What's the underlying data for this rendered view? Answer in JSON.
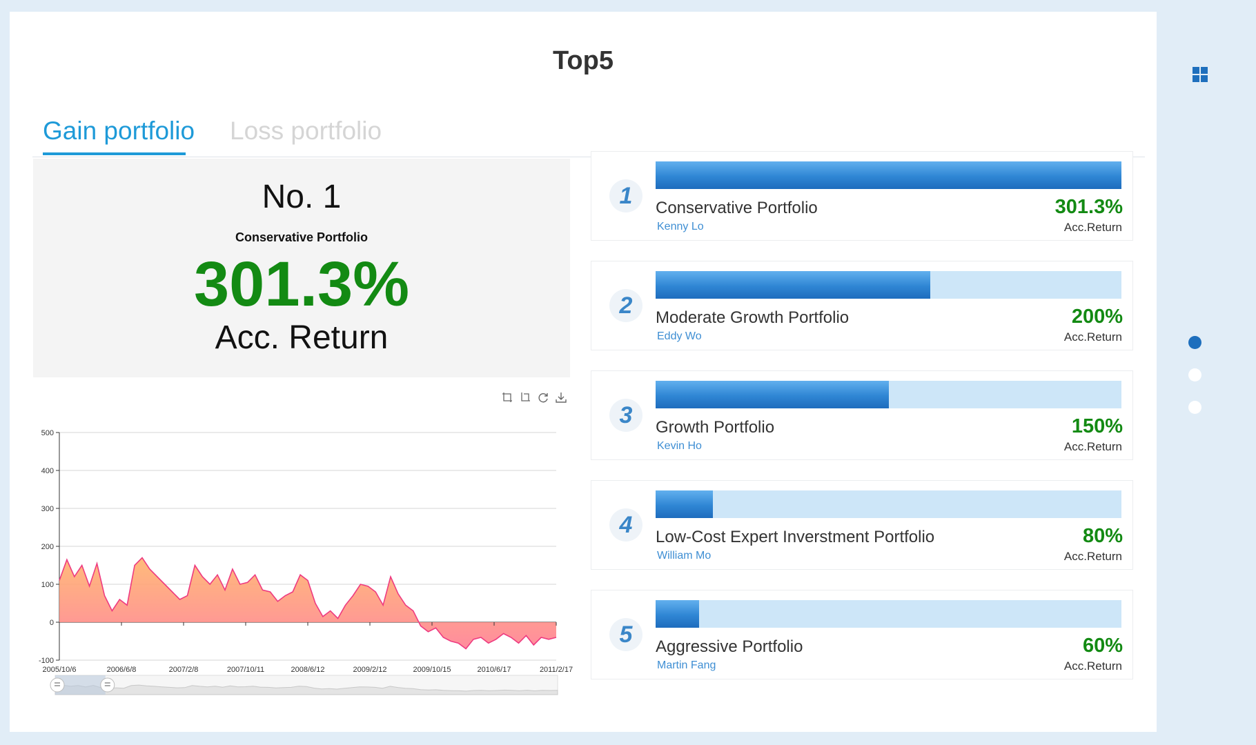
{
  "page": {
    "title": "Top5"
  },
  "tabs": [
    {
      "label": "Gain portfolio",
      "active": true
    },
    {
      "label": "Loss portfolio",
      "active": false
    }
  ],
  "hero": {
    "rank": "No. 1",
    "name": "Conservative Portfolio",
    "value": "301.3%",
    "label": "Acc. Return"
  },
  "toolbox": {
    "icons": [
      "zoom-icon",
      "zoom-reset-icon",
      "restore-icon",
      "download-icon"
    ]
  },
  "ranking": [
    {
      "rank": "1",
      "name": "Conservative Portfolio",
      "owner": "Kenny Lo",
      "value": "301.3%",
      "label": "Acc.Return",
      "fill": 1.0
    },
    {
      "rank": "2",
      "name": "Moderate Growth Portfolio",
      "owner": "Eddy Wo",
      "value": "200%",
      "label": "Acc.Return",
      "fill": 0.589
    },
    {
      "rank": "3",
      "name": "Growth Portfolio",
      "owner": "Kevin Ho",
      "value": "150%",
      "label": "Acc.Return",
      "fill": 0.501
    },
    {
      "rank": "4",
      "name": "Low-Cost Expert Inverstment Portfolio",
      "owner": "William Mo",
      "value": "80%",
      "label": "Acc.Return",
      "fill": 0.123
    },
    {
      "rank": "5",
      "name": "Aggressive Portfolio",
      "owner": "Martin Fang",
      "value": "60%",
      "label": "Acc.Return",
      "fill": 0.093
    }
  ],
  "side_nav": {
    "grid_icon": "grid-icon",
    "dots": [
      true,
      false,
      false
    ]
  },
  "colors": {
    "accent": "#1e9ad8",
    "positive": "#138a13",
    "bar": "#2f86d4",
    "track": "#cde6f8",
    "area_line": "#ee3a80"
  },
  "chart_data": {
    "type": "area",
    "title": "",
    "xlabel": "",
    "ylabel": "",
    "ylim": [
      -100,
      500
    ],
    "yticks": [
      -100,
      0,
      100,
      200,
      300,
      400,
      500
    ],
    "xticks": [
      "2005/10/6",
      "2006/6/8",
      "2007/2/8",
      "2007/10/11",
      "2008/6/12",
      "2009/2/12",
      "2009/10/15",
      "2010/6/17",
      "2011/2/17"
    ],
    "grid": true,
    "data_zoom_slider": true,
    "series": [
      {
        "x": [
          "2005/10/6",
          "2005/11/3",
          "2005/12/1",
          "2006/1/5",
          "2006/2/2",
          "2006/3/2",
          "2006/4/6",
          "2006/5/4",
          "2006/6/8",
          "2006/7/6",
          "2006/8/3",
          "2006/9/7",
          "2006/10/5",
          "2006/11/2",
          "2006/12/7",
          "2007/1/4",
          "2007/2/8",
          "2007/3/8",
          "2007/4/5",
          "2007/5/3",
          "2007/6/7",
          "2007/7/5",
          "2007/8/2",
          "2007/9/6",
          "2007/10/11",
          "2007/11/8",
          "2007/12/6",
          "2008/1/3",
          "2008/2/7",
          "2008/3/6",
          "2008/4/3",
          "2008/5/8",
          "2008/6/12",
          "2008/7/10",
          "2008/8/7",
          "2008/9/4",
          "2008/10/9",
          "2008/11/6",
          "2008/12/4",
          "2009/1/8",
          "2009/2/12",
          "2009/3/12",
          "2009/4/9",
          "2009/5/7",
          "2009/6/4",
          "2009/7/9",
          "2009/8/6",
          "2009/9/3",
          "2009/10/15",
          "2009/11/12",
          "2009/12/10",
          "2010/1/7",
          "2010/2/4",
          "2010/3/4",
          "2010/4/8",
          "2010/5/6",
          "2010/6/17",
          "2010/7/15",
          "2010/8/12",
          "2010/9/9",
          "2010/10/7",
          "2010/11/4",
          "2010/12/2",
          "2011/1/6",
          "2011/2/17",
          "2011/3/17",
          "2011/4/14"
        ],
        "values": [
          110,
          165,
          120,
          150,
          95,
          155,
          70,
          30,
          60,
          45,
          150,
          170,
          140,
          120,
          100,
          80,
          60,
          70,
          150,
          120,
          100,
          125,
          85,
          140,
          100,
          105,
          125,
          85,
          80,
          55,
          70,
          80,
          125,
          110,
          50,
          15,
          30,
          10,
          45,
          70,
          100,
          95,
          80,
          45,
          120,
          75,
          45,
          30,
          -10,
          -25,
          -15,
          -40,
          -50,
          -55,
          -70,
          -45,
          -40,
          -55,
          -45,
          -30,
          -40,
          -55,
          -35,
          -60,
          -40,
          -45,
          -40
        ]
      }
    ]
  }
}
